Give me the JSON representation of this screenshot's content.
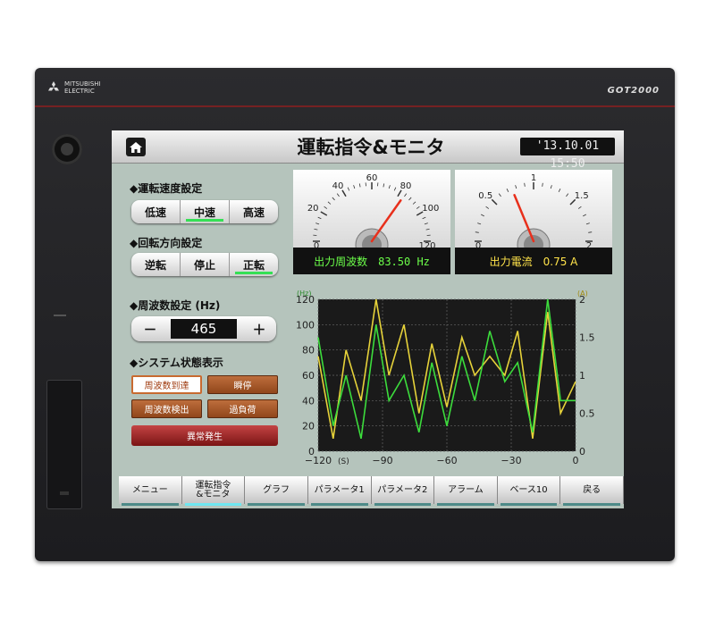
{
  "device": {
    "brand_line1": "MITSUBISHI",
    "brand_line2": "ELECTRIC",
    "model": "GOT2000"
  },
  "header": {
    "title": "運転指令&モニタ",
    "clock": "'13.10.01 15:50",
    "home_icon": "home-icon"
  },
  "speed": {
    "heading": "◆運転速度設定",
    "options": [
      "低速",
      "中速",
      "高速"
    ],
    "selected": "中速"
  },
  "direction": {
    "heading": "◆回転方向設定",
    "options": [
      "逆転",
      "停止",
      "正転"
    ],
    "selected": "正転"
  },
  "frequency": {
    "heading": "◆周波数設定 (Hz)",
    "minus": "－",
    "plus": "＋",
    "value": "465"
  },
  "system": {
    "heading": "◆システム状態表示",
    "items": [
      "周波数到達",
      "瞬停",
      "周波数検出",
      "過負荷"
    ],
    "alarm": "異常発生",
    "colors": {
      "lit": "#ffffff",
      "off": "#a8582a",
      "alarm": "#a32020"
    }
  },
  "meters": [
    {
      "scale": [
        "0",
        "20",
        "40",
        "60",
        "80",
        "100",
        "120"
      ],
      "min": 0,
      "max": 120,
      "value": 83.5,
      "label": "出力周波数　83.50 Hz"
    },
    {
      "scale": [
        "0",
        "0.5",
        "1",
        "1.5",
        "2"
      ],
      "min": 0,
      "max": 2,
      "value": 0.75,
      "label": "出力電流　0.75 A"
    }
  ],
  "chart_data": {
    "type": "line",
    "x_ticks": [
      "−120",
      "−90",
      "−60",
      "−30",
      "0"
    ],
    "x_unit": "(S)",
    "y_left_unit": "(Hz)",
    "y_right_unit": "(A)",
    "y_left_ticks": [
      "0",
      "20",
      "40",
      "60",
      "80",
      "100",
      "120"
    ],
    "y_right_ticks": [
      "0",
      "0.5",
      "1",
      "1.5",
      "2"
    ],
    "xlim": [
      -120,
      0
    ],
    "ylim_left": [
      0,
      120
    ],
    "ylim_right": [
      0,
      2
    ],
    "x": [
      -120,
      -113,
      -107,
      -100,
      -93,
      -87,
      -80,
      -73,
      -67,
      -60,
      -53,
      -47,
      -40,
      -33,
      -27,
      -20,
      -13,
      -7,
      0
    ],
    "series": [
      {
        "axis": "left",
        "color": "#e6d23a",
        "values": [
          75,
          10,
          80,
          40,
          120,
          60,
          100,
          30,
          85,
          35,
          90,
          60,
          75,
          60,
          95,
          10,
          110,
          30,
          55
        ]
      },
      {
        "axis": "left",
        "color": "#3cdc3c",
        "values": [
          90,
          20,
          60,
          10,
          100,
          40,
          60,
          15,
          70,
          20,
          75,
          40,
          95,
          55,
          70,
          15,
          120,
          40,
          40
        ]
      }
    ],
    "grid": true,
    "background": "#1a1a1a"
  },
  "tabs": [
    {
      "label": "メニュー",
      "active": false
    },
    {
      "label": "運転指令\n&モニタ",
      "active": true
    },
    {
      "label": "グラフ",
      "active": false
    },
    {
      "label": "パラメータ1",
      "active": false
    },
    {
      "label": "パラメータ2",
      "active": false
    },
    {
      "label": "アラーム",
      "active": false
    },
    {
      "label": "ベース10",
      "active": false
    },
    {
      "label": "戻る",
      "active": false
    }
  ]
}
